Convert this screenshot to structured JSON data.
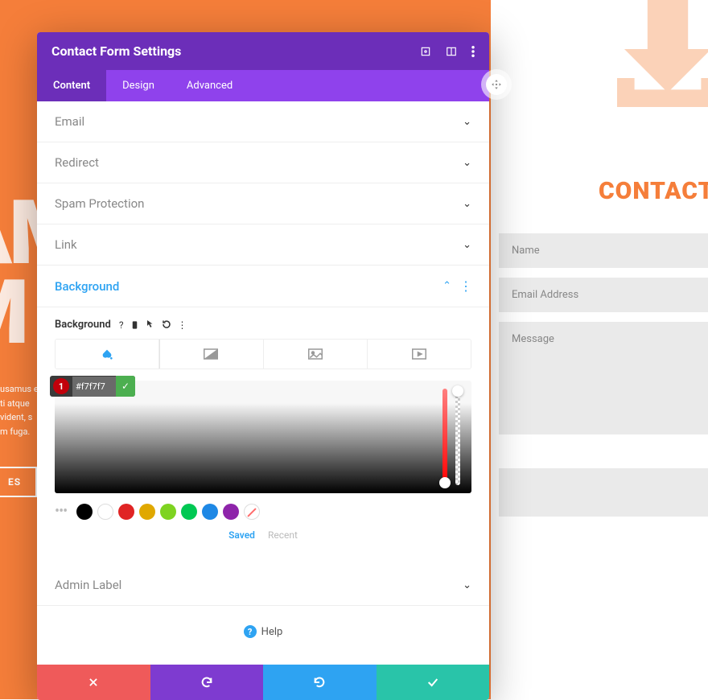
{
  "bg": {
    "title_line1": "AM",
    "title_line2": "M",
    "body_lines": [
      "usamus e",
      "ti atque",
      "vident, s",
      "m fuga."
    ],
    "button": "ES"
  },
  "contact": {
    "title": "CONTACT U",
    "name_placeholder": "Name",
    "email_placeholder": "Email Address",
    "message_placeholder": "Message"
  },
  "modal": {
    "title": "Contact Form Settings",
    "tabs": {
      "content": "Content",
      "design": "Design",
      "advanced": "Advanced"
    },
    "sections": {
      "email": "Email",
      "redirect": "Redirect",
      "spam": "Spam Protection",
      "link": "Link",
      "background": "Background",
      "admin_label": "Admin Label"
    },
    "bg_sublabel": "Background",
    "hex_badge": "1",
    "hex_value": "#f7f7f7",
    "saved_label": "Saved",
    "recent_label": "Recent",
    "help_label": "Help",
    "swatches": [
      "#000000",
      "#ffffff",
      "#e02424",
      "#e0a800",
      "#7ed321",
      "#00c853",
      "#1e88e5",
      "#8e24aa"
    ]
  }
}
